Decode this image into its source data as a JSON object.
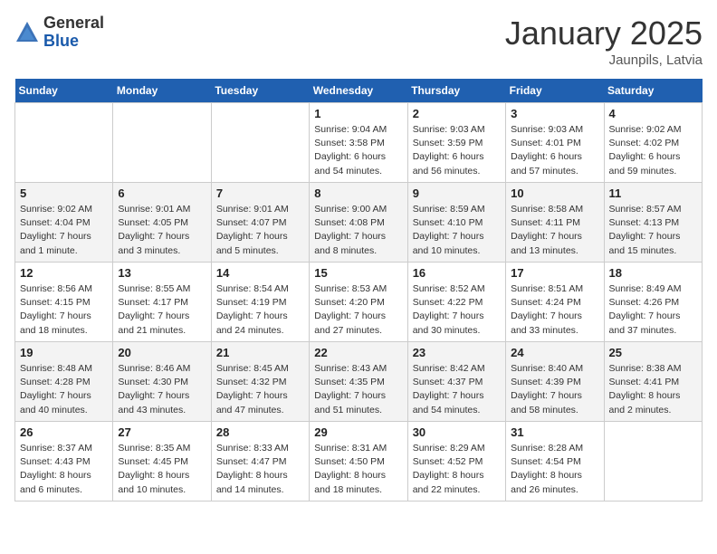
{
  "logo": {
    "general": "General",
    "blue": "Blue"
  },
  "title": "January 2025",
  "location": "Jaunpils, Latvia",
  "weekdays": [
    "Sunday",
    "Monday",
    "Tuesday",
    "Wednesday",
    "Thursday",
    "Friday",
    "Saturday"
  ],
  "weeks": [
    [
      {
        "day": "",
        "info": ""
      },
      {
        "day": "",
        "info": ""
      },
      {
        "day": "",
        "info": ""
      },
      {
        "day": "1",
        "info": "Sunrise: 9:04 AM\nSunset: 3:58 PM\nDaylight: 6 hours\nand 54 minutes."
      },
      {
        "day": "2",
        "info": "Sunrise: 9:03 AM\nSunset: 3:59 PM\nDaylight: 6 hours\nand 56 minutes."
      },
      {
        "day": "3",
        "info": "Sunrise: 9:03 AM\nSunset: 4:01 PM\nDaylight: 6 hours\nand 57 minutes."
      },
      {
        "day": "4",
        "info": "Sunrise: 9:02 AM\nSunset: 4:02 PM\nDaylight: 6 hours\nand 59 minutes."
      }
    ],
    [
      {
        "day": "5",
        "info": "Sunrise: 9:02 AM\nSunset: 4:04 PM\nDaylight: 7 hours\nand 1 minute."
      },
      {
        "day": "6",
        "info": "Sunrise: 9:01 AM\nSunset: 4:05 PM\nDaylight: 7 hours\nand 3 minutes."
      },
      {
        "day": "7",
        "info": "Sunrise: 9:01 AM\nSunset: 4:07 PM\nDaylight: 7 hours\nand 5 minutes."
      },
      {
        "day": "8",
        "info": "Sunrise: 9:00 AM\nSunset: 4:08 PM\nDaylight: 7 hours\nand 8 minutes."
      },
      {
        "day": "9",
        "info": "Sunrise: 8:59 AM\nSunset: 4:10 PM\nDaylight: 7 hours\nand 10 minutes."
      },
      {
        "day": "10",
        "info": "Sunrise: 8:58 AM\nSunset: 4:11 PM\nDaylight: 7 hours\nand 13 minutes."
      },
      {
        "day": "11",
        "info": "Sunrise: 8:57 AM\nSunset: 4:13 PM\nDaylight: 7 hours\nand 15 minutes."
      }
    ],
    [
      {
        "day": "12",
        "info": "Sunrise: 8:56 AM\nSunset: 4:15 PM\nDaylight: 7 hours\nand 18 minutes."
      },
      {
        "day": "13",
        "info": "Sunrise: 8:55 AM\nSunset: 4:17 PM\nDaylight: 7 hours\nand 21 minutes."
      },
      {
        "day": "14",
        "info": "Sunrise: 8:54 AM\nSunset: 4:19 PM\nDaylight: 7 hours\nand 24 minutes."
      },
      {
        "day": "15",
        "info": "Sunrise: 8:53 AM\nSunset: 4:20 PM\nDaylight: 7 hours\nand 27 minutes."
      },
      {
        "day": "16",
        "info": "Sunrise: 8:52 AM\nSunset: 4:22 PM\nDaylight: 7 hours\nand 30 minutes."
      },
      {
        "day": "17",
        "info": "Sunrise: 8:51 AM\nSunset: 4:24 PM\nDaylight: 7 hours\nand 33 minutes."
      },
      {
        "day": "18",
        "info": "Sunrise: 8:49 AM\nSunset: 4:26 PM\nDaylight: 7 hours\nand 37 minutes."
      }
    ],
    [
      {
        "day": "19",
        "info": "Sunrise: 8:48 AM\nSunset: 4:28 PM\nDaylight: 7 hours\nand 40 minutes."
      },
      {
        "day": "20",
        "info": "Sunrise: 8:46 AM\nSunset: 4:30 PM\nDaylight: 7 hours\nand 43 minutes."
      },
      {
        "day": "21",
        "info": "Sunrise: 8:45 AM\nSunset: 4:32 PM\nDaylight: 7 hours\nand 47 minutes."
      },
      {
        "day": "22",
        "info": "Sunrise: 8:43 AM\nSunset: 4:35 PM\nDaylight: 7 hours\nand 51 minutes."
      },
      {
        "day": "23",
        "info": "Sunrise: 8:42 AM\nSunset: 4:37 PM\nDaylight: 7 hours\nand 54 minutes."
      },
      {
        "day": "24",
        "info": "Sunrise: 8:40 AM\nSunset: 4:39 PM\nDaylight: 7 hours\nand 58 minutes."
      },
      {
        "day": "25",
        "info": "Sunrise: 8:38 AM\nSunset: 4:41 PM\nDaylight: 8 hours\nand 2 minutes."
      }
    ],
    [
      {
        "day": "26",
        "info": "Sunrise: 8:37 AM\nSunset: 4:43 PM\nDaylight: 8 hours\nand 6 minutes."
      },
      {
        "day": "27",
        "info": "Sunrise: 8:35 AM\nSunset: 4:45 PM\nDaylight: 8 hours\nand 10 minutes."
      },
      {
        "day": "28",
        "info": "Sunrise: 8:33 AM\nSunset: 4:47 PM\nDaylight: 8 hours\nand 14 minutes."
      },
      {
        "day": "29",
        "info": "Sunrise: 8:31 AM\nSunset: 4:50 PM\nDaylight: 8 hours\nand 18 minutes."
      },
      {
        "day": "30",
        "info": "Sunrise: 8:29 AM\nSunset: 4:52 PM\nDaylight: 8 hours\nand 22 minutes."
      },
      {
        "day": "31",
        "info": "Sunrise: 8:28 AM\nSunset: 4:54 PM\nDaylight: 8 hours\nand 26 minutes."
      },
      {
        "day": "",
        "info": ""
      }
    ]
  ]
}
